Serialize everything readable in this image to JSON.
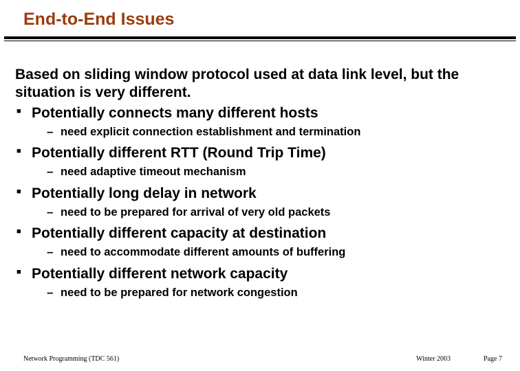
{
  "title": "End-to-End Issues",
  "intro": "Based on sliding window protocol used at data link level, but the situation is very different.",
  "bullets": [
    {
      "text": "Potentially connects many different hosts",
      "sub": "need explicit connection establishment and termination"
    },
    {
      "text": "Potentially different RTT (Round Trip Time)",
      "sub": "need adaptive timeout mechanism"
    },
    {
      "text": "Potentially long delay in network",
      "sub": "need to be prepared for arrival of very old packets"
    },
    {
      "text": "Potentially different capacity at destination",
      "sub": "need to accommodate different amounts of buffering"
    },
    {
      "text": "Potentially different network capacity",
      "sub": "need to be prepared for network congestion"
    }
  ],
  "footer": {
    "left": "Network Programming (TDC 561)",
    "center": "Winter  2003",
    "right": "Page 7"
  }
}
